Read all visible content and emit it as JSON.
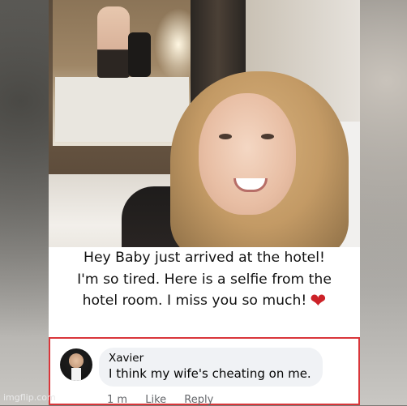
{
  "caption": {
    "line1": "Hey Baby just arrived at the hotel!",
    "line2": "I'm so tired. Here is a selfie from the",
    "line3": "hotel room. I miss you so much!",
    "heart_color": "#cc2228"
  },
  "comment": {
    "author": "Xavier",
    "text": "I think my wife's cheating on me.",
    "time": "1 m",
    "like": "Like",
    "reply": "Reply"
  },
  "watermark": "imgflip.com"
}
